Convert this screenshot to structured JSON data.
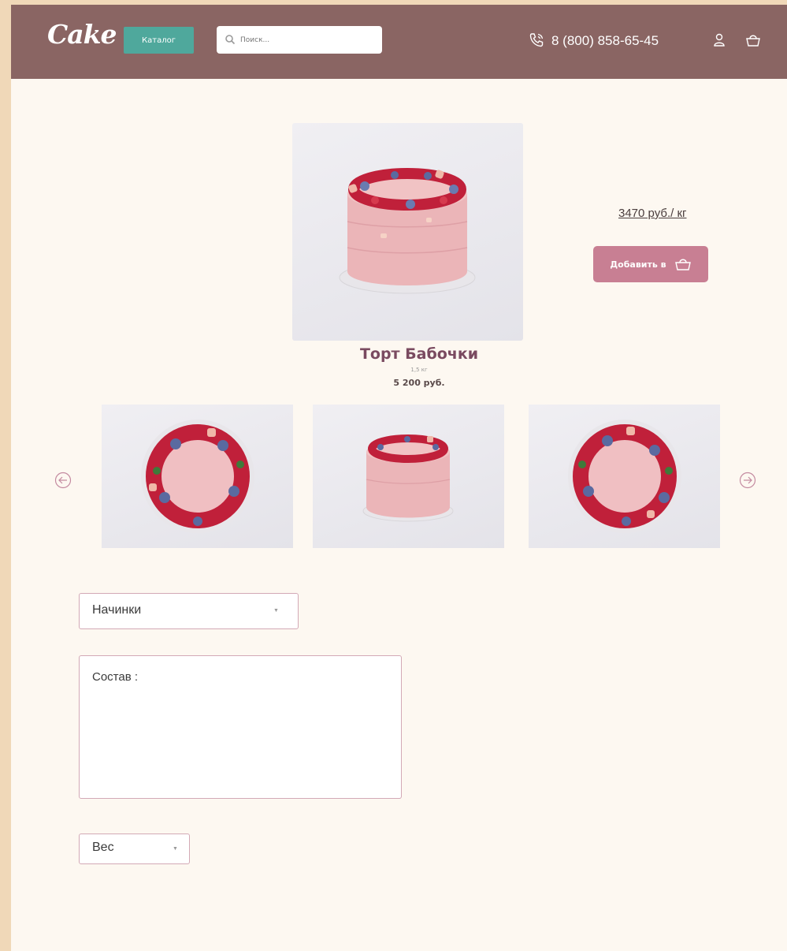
{
  "header": {
    "logo": "Cake",
    "catalog_label": "Каталог",
    "search_placeholder": "Поиск...",
    "phone": "8 (800) 858-65-45"
  },
  "product": {
    "name": "Торт Бабочки",
    "weight": "1,5 кг",
    "price": "5 200 руб.",
    "price_per_kg": "3470 руб./ кг",
    "add_to_cart_label": "Добавить в"
  },
  "options": {
    "fillings_label": "Начинки",
    "composition_label": "Состав :",
    "weight_label": "Вес"
  },
  "colors": {
    "header_bg": "#8a6563",
    "accent_teal": "#4fa89c",
    "add_button": "#c87f93",
    "page_bg": "#fdf8f1"
  }
}
